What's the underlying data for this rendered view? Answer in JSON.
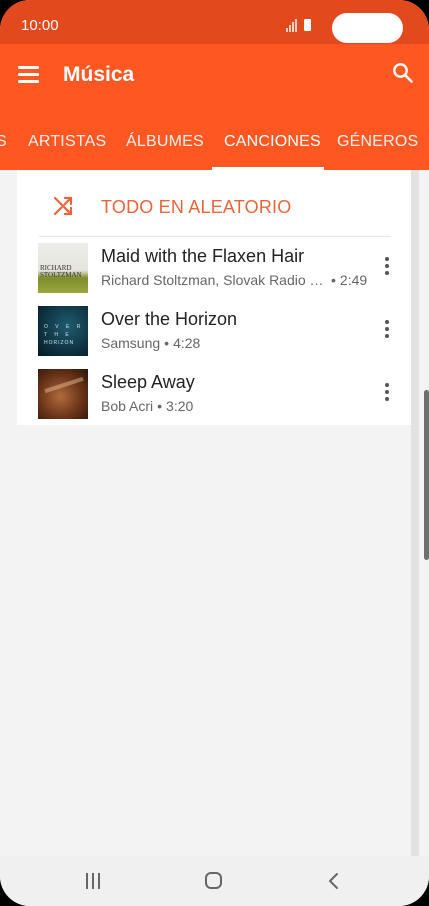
{
  "status_bar": {
    "time": "10:00"
  },
  "toolbar": {
    "title": "Música"
  },
  "tabs": {
    "partial": "S",
    "artists": "ARTISTAS",
    "albums": "ÁLBUMES",
    "songs": "CANCIONES",
    "genres": "GÉNEROS",
    "selected": "CANCIONES"
  },
  "shuffle": {
    "label": "TODO EN ALEATORIO"
  },
  "songs": [
    {
      "title": "Maid with the Flaxen Hair",
      "artist": "Richard Stoltzman, Slovak Radio Sy..",
      "duration": "2:49",
      "cover_text": [
        "RICHARD",
        "STOLTZMAN"
      ]
    },
    {
      "title": "Over the Horizon",
      "artist": "Samsung",
      "duration": "4:28",
      "cover_text": [
        "O V E R",
        "T H E",
        "HORIZON"
      ]
    },
    {
      "title": "Sleep Away",
      "artist": "Bob Acri",
      "duration": "3:20"
    }
  ],
  "colors": {
    "accent": "#fe5722",
    "status_bar": "#e24a1e",
    "shuffle_text": "#e8653a"
  },
  "icons": {
    "menu": "menu-icon",
    "search": "search-icon",
    "shuffle": "shuffle-icon",
    "more": "more-vertical-icon",
    "nav_recents": "recents-icon",
    "nav_home": "home-icon",
    "nav_back": "back-icon"
  }
}
